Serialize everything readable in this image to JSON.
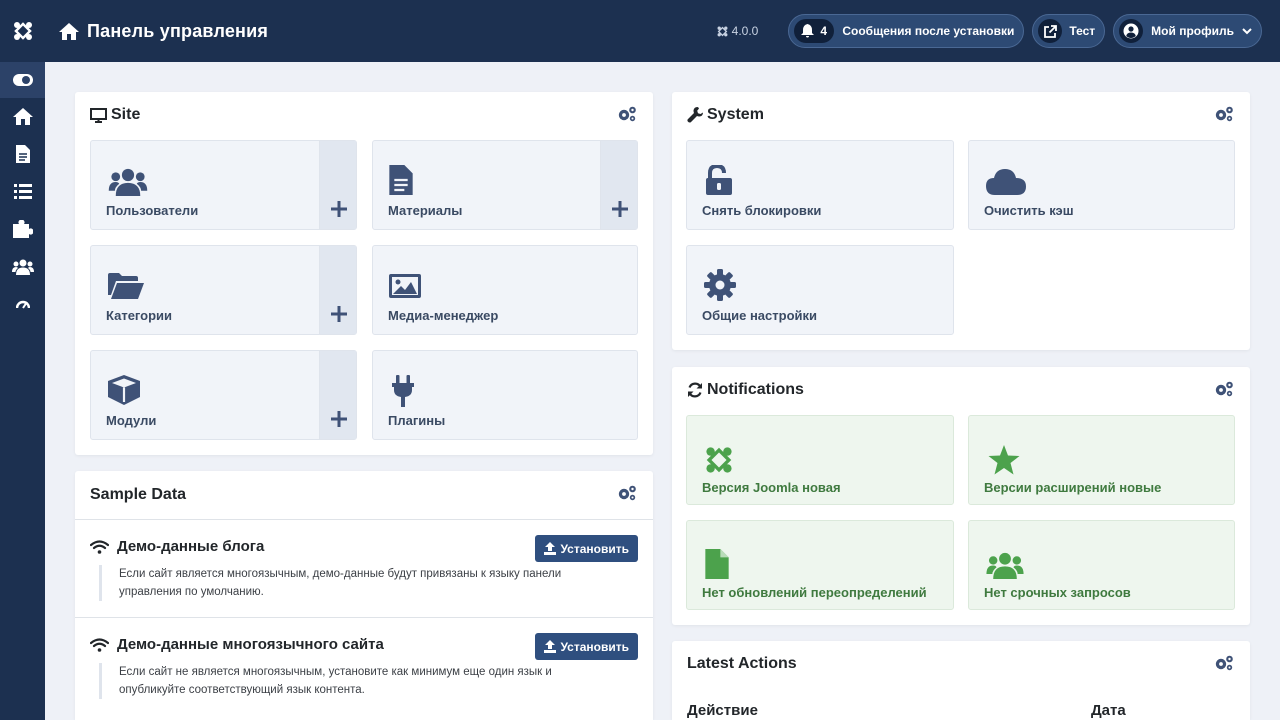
{
  "header": {
    "title": "Панель управления",
    "version": "4.0.0",
    "notifications": {
      "count": "4",
      "label": "Сообщения после установки"
    },
    "preview": {
      "label": "Тест"
    },
    "profile": {
      "label": "Мой профиль"
    }
  },
  "sidebar": {
    "items": [
      {
        "icon": "toggle-icon"
      },
      {
        "icon": "home-icon"
      },
      {
        "icon": "file-icon"
      },
      {
        "icon": "list-icon"
      },
      {
        "icon": "puzzle-icon"
      },
      {
        "icon": "users-icon"
      },
      {
        "icon": "gauge-icon"
      }
    ]
  },
  "site": {
    "title": "Site",
    "tiles": [
      {
        "label": "Пользователи",
        "icon": "users-icon",
        "add": true
      },
      {
        "label": "Материалы",
        "icon": "file-icon",
        "add": true
      },
      {
        "label": "Категории",
        "icon": "folder-icon",
        "add": true
      },
      {
        "label": "Медиа-менеджер",
        "icon": "image-icon",
        "add": false
      },
      {
        "label": "Модули",
        "icon": "cube-icon",
        "add": true
      },
      {
        "label": "Плагины",
        "icon": "plug-icon",
        "add": false
      }
    ]
  },
  "system": {
    "title": "System",
    "tiles": [
      {
        "label": "Снять блокировки",
        "icon": "unlock-icon"
      },
      {
        "label": "Очистить кэш",
        "icon": "cloud-icon"
      },
      {
        "label": "Общие настройки",
        "icon": "gear-icon"
      }
    ]
  },
  "notifications": {
    "title": "Notifications",
    "tiles": [
      {
        "label": "Версия Joomla новая",
        "icon": "joomla-icon"
      },
      {
        "label": "Версии расширений новые",
        "icon": "star-icon"
      },
      {
        "label": "Нет обновлений переопределений",
        "icon": "file-icon"
      },
      {
        "label": "Нет срочных запросов",
        "icon": "users-icon"
      }
    ]
  },
  "sample_data": {
    "title": "Sample Data",
    "install_label": "Установить",
    "items": [
      {
        "title": "Демо-данные блога",
        "desc": "Если сайт является многоязычным, демо-данные будут привязаны к языку панели управления по умолчанию."
      },
      {
        "title": "Демо-данные многоязычного сайта",
        "desc": "Если сайт не является многоязычным, установите как минимум еще один язык и опубликуйте соответствующий язык контента."
      }
    ]
  },
  "latest_actions": {
    "title": "Latest Actions",
    "columns": [
      "Действие",
      "Дата"
    ]
  },
  "colors": {
    "navy": "#1c3050",
    "tile_icon": "#3f5277",
    "green": "#4ca24c",
    "button": "#2f4f7f"
  }
}
